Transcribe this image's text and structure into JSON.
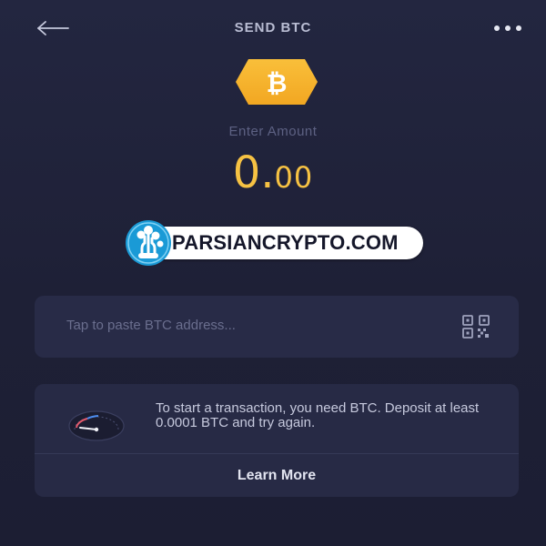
{
  "header": {
    "title": "SEND BTC",
    "back_icon": "arrow-left-icon",
    "more_icon": "more-horizontal-icon"
  },
  "coin": {
    "icon": "bitcoin-icon",
    "symbol": "₿",
    "color": "#f6b32d"
  },
  "amount": {
    "label": "Enter Amount",
    "whole": "0.",
    "fraction": "00",
    "color": "#f6c243"
  },
  "watermark": {
    "text": "PARSIANCRYPTO.COM",
    "logo_icon": "parsiancrypto-logo-icon",
    "logo_color": "#1a9ad6"
  },
  "address": {
    "placeholder": "Tap to paste BTC address...",
    "value": "",
    "qr_icon": "qr-code-icon"
  },
  "info_card": {
    "icon": "gauge-icon",
    "message": "To start a transaction, you need BTC. Deposit at least 0.0001 BTC and try again.",
    "action_label": "Learn More"
  }
}
